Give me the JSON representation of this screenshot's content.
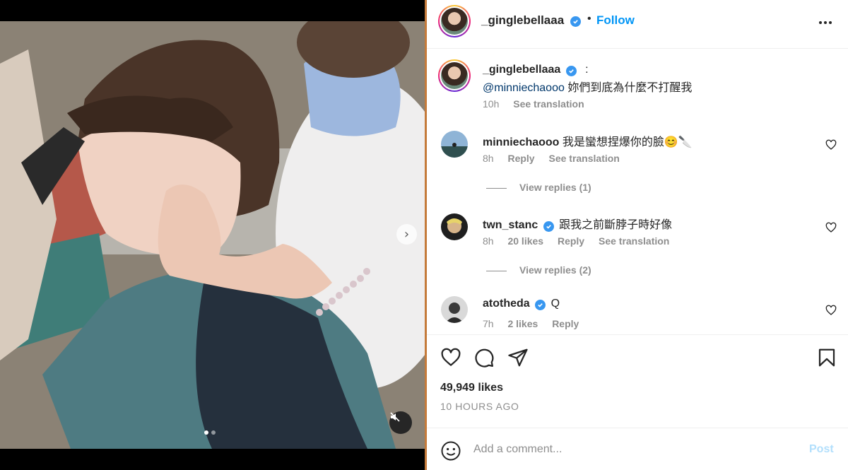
{
  "post": {
    "username": "_ginglebellaaa",
    "separator": "•",
    "follow_label": "Follow",
    "more_icon": "more-horizontal-icon"
  },
  "caption": {
    "username": "_ginglebellaaa",
    "colon": ":",
    "mention": "@minniechaooo",
    "text": "妳們到底為什麼不打醒我",
    "time": "10h",
    "see_translation": "See translation"
  },
  "comments": [
    {
      "username": "minniechaooo",
      "verified": false,
      "text": "我是蠻想捏爆你的臉😊🔪",
      "time": "8h",
      "likes": "",
      "reply": "Reply",
      "see_translation": "See translation",
      "view_replies": "View replies (1)"
    },
    {
      "username": "twn_stanc",
      "verified": true,
      "text": "跟我之前斷脖子時好像",
      "time": "8h",
      "likes": "20 likes",
      "reply": "Reply",
      "see_translation": "See translation",
      "view_replies": "View replies (2)"
    },
    {
      "username": "atotheda",
      "verified": true,
      "text": "Q",
      "time": "7h",
      "likes": "2 likes",
      "reply": "Reply"
    }
  ],
  "actions": {
    "like_icon": "heart-icon",
    "comment_icon": "comment-icon",
    "share_icon": "share-icon",
    "save_icon": "bookmark-icon",
    "likes_count": "49,949 likes",
    "posted_ago": "10 HOURS AGO"
  },
  "compose": {
    "placeholder": "Add a comment...",
    "post_label": "Post",
    "emoji_icon": "emoji-icon"
  },
  "media": {
    "carousel_total": 2,
    "carousel_index": 1,
    "muted": true
  },
  "colors": {
    "accent": "#0095f6",
    "verified": "#3897f0",
    "post_disabled": "#b2dffc",
    "muted_text": "#8e8e8e"
  }
}
